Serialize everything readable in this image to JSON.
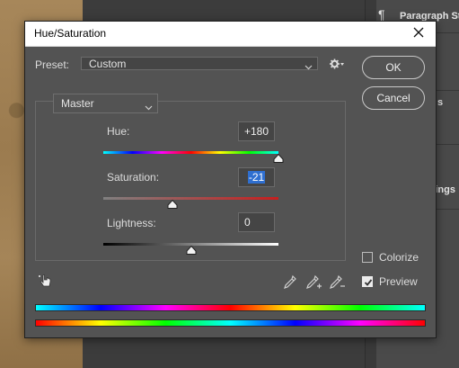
{
  "background": {
    "panel_label_1": "Paragraph Sty",
    "panel_label_2": "s",
    "panel_label_3": "ttings"
  },
  "dialog": {
    "title": "Hue/Saturation",
    "preset_label": "Preset:",
    "preset_value": "Custom",
    "ok_label": "OK",
    "cancel_label": "Cancel",
    "channel_value": "Master",
    "hue_label": "Hue:",
    "hue_value": "+180",
    "saturation_label": "Saturation:",
    "saturation_value": "-21",
    "lightness_label": "Lightness:",
    "lightness_value": "0",
    "colorize_label": "Colorize",
    "colorize_checked": false,
    "preview_label": "Preview",
    "preview_checked": true
  },
  "sliders": {
    "hue_position": 1.0,
    "saturation_position": 0.395,
    "lightness_position": 0.5
  },
  "icons": {
    "close": "close-icon",
    "gear": "gear-icon",
    "targeted_adjustment": "hand-pointer-icon",
    "eyedropper": "eyedropper-icon",
    "eyedropper_plus": "eyedropper-plus-icon",
    "eyedropper_minus": "eyedropper-minus-icon"
  },
  "colors": {
    "dialog_bg": "#535353",
    "selection": "#2f6fd0",
    "saturation_track_end": "#c81e1e"
  }
}
